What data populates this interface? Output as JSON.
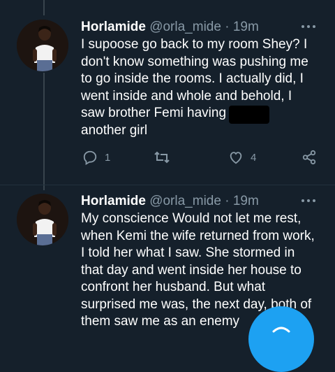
{
  "tweets": [
    {
      "display_name": "Horlamide",
      "handle": "@orla_mide",
      "separator": "·",
      "time": "19m",
      "lines": [
        "I supoose go back to my room Shey? I",
        "don't know something was pushing me",
        "to go inside the rooms.  I actually did, I",
        "went inside and whole and behold, I",
        "saw brother Femi having s      th",
        "another girl"
      ],
      "replies": "1",
      "retweets": "",
      "likes": "4"
    },
    {
      "display_name": "Horlamide",
      "handle": "@orla_mide",
      "separator": "·",
      "time": "19m",
      "lines": [
        "My conscience Would not let me rest,",
        "when Kemi the wife returned from work,",
        "I told her what I saw. She stormed in",
        "that day and went inside her house to",
        "confront her husband. But what",
        "surprised me was, the next day, both of",
        "them saw me as an enemy"
      ]
    }
  ],
  "icons": [
    "reply-icon",
    "retweet-icon",
    "like-icon",
    "share-icon",
    "more-icon",
    "compose-icon"
  ],
  "colors": {
    "background": "#15202b",
    "secondary_text": "#8899a6",
    "accent": "#1da1f2"
  }
}
